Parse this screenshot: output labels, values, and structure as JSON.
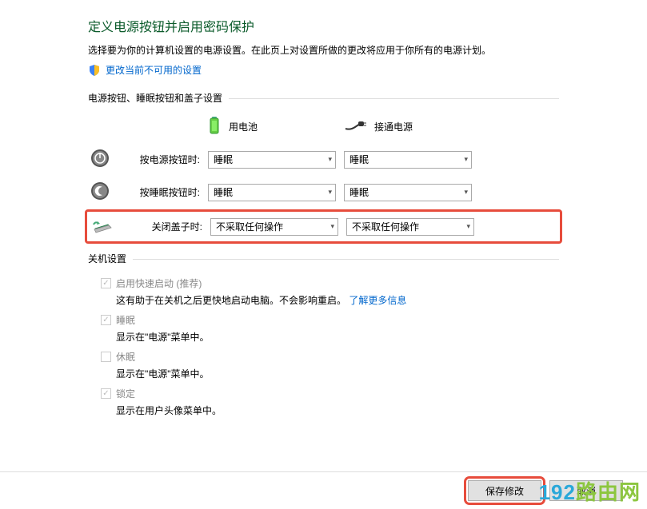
{
  "title": "定义电源按钮并启用密码保护",
  "desc": "选择要为你的计算机设置的电源设置。在此页上对设置所做的更改将应用于你所有的电源计划。",
  "change_link": "更改当前不可用的设置",
  "group1": {
    "header": "电源按钮、睡眠按钮和盖子设置",
    "battery_col": "用电池",
    "plugged_col": "接通电源",
    "rows": {
      "power": {
        "label": "按电源按钮时:",
        "battery": "睡眠",
        "plugged": "睡眠"
      },
      "sleep": {
        "label": "按睡眠按钮时:",
        "battery": "睡眠",
        "plugged": "睡眠"
      },
      "lid": {
        "label": "关闭盖子时:",
        "battery": "不采取任何操作",
        "plugged": "不采取任何操作"
      }
    }
  },
  "group2": {
    "header": "关机设置",
    "fast": {
      "label": "启用快速启动 (推荐)",
      "desc_a": "这有助于在关机之后更快地启动电脑。不会影响重启。",
      "link": "了解更多信息"
    },
    "sleep": {
      "label": "睡眠",
      "desc": "显示在\"电源\"菜单中。"
    },
    "hibernate": {
      "label": "休眠",
      "desc": "显示在\"电源\"菜单中。"
    },
    "lock": {
      "label": "锁定",
      "desc": "显示在用户头像菜单中。"
    }
  },
  "footer": {
    "save": "保存修改",
    "cancel": "取消"
  },
  "watermark": {
    "a": "192",
    "b": "路由网"
  }
}
